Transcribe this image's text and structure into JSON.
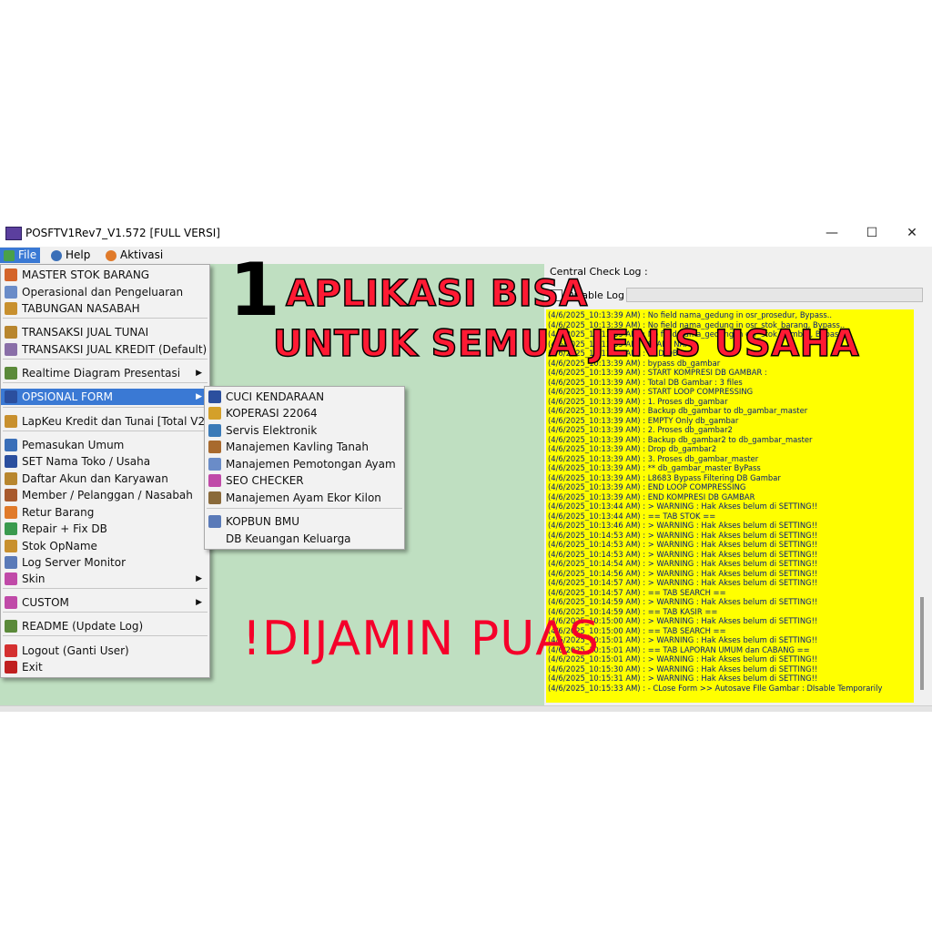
{
  "window": {
    "title": "POSFTV1Rev7_V1.572 [FULL VERSI]",
    "minimize": "—",
    "maximize": "☐",
    "close": "✕"
  },
  "menubar": [
    {
      "label": "File",
      "icon": "file-icon"
    },
    {
      "label": "Help",
      "icon": "help-icon"
    },
    {
      "label": "Aktivasi",
      "icon": "activation-icon"
    }
  ],
  "main_menu": {
    "items": [
      {
        "label": "MASTER STOK BARANG",
        "icon_color": "#d4642a"
      },
      {
        "label": "Operasional dan Pengeluaran",
        "icon_color": "#6a8cc8"
      },
      {
        "label": "TABUNGAN NASABAH",
        "icon_color": "#c8902e"
      },
      {
        "label": "TRANSAKSI JUAL TUNAI",
        "icon_color": "#b8862e"
      },
      {
        "label": "TRANSAKSI JUAL KREDIT (Default)",
        "icon_color": "#8a6fa8"
      },
      {
        "label": "Realtime Diagram Presentasi",
        "icon_color": "#5b8a3a"
      },
      {
        "label": "OPSIONAL FORM",
        "icon_color": "#2b4f9e"
      },
      {
        "label": "LapKeu Kredit dan Tunai [Total V2]",
        "icon_color": "#c8902e"
      },
      {
        "label": "Pemasukan Umum",
        "icon_color": "#3a6fb8"
      },
      {
        "label": "SET Nama Toko / Usaha",
        "icon_color": "#2b4f9e"
      },
      {
        "label": "Daftar Akun dan Karyawan",
        "icon_color": "#b8862e"
      },
      {
        "label": "Member / Pelanggan / Nasabah",
        "icon_color": "#a85a2e"
      },
      {
        "label": "Retur Barang",
        "icon_color": "#e07a2a"
      },
      {
        "label": "Repair + Fix DB",
        "icon_color": "#3a9a4e"
      },
      {
        "label": "Stok OpName",
        "icon_color": "#c8902e"
      },
      {
        "label": "Log Server Monitor",
        "icon_color": "#5a7ab8"
      },
      {
        "label": "Skin",
        "icon_color": "#c04aa8"
      },
      {
        "label": "CUSTOM",
        "icon_color": "#c04aa8"
      },
      {
        "label": "README (Update Log)",
        "icon_color": "#5b8a3a"
      },
      {
        "label": "Logout (Ganti User)",
        "icon_color": "#d43030"
      },
      {
        "label": "Exit",
        "icon_color": "#c02020"
      }
    ]
  },
  "sub_menu": {
    "items": [
      {
        "label": "CUCI KENDARAAN",
        "icon_color": "#2b4f9e"
      },
      {
        "label": "KOPERASI 22064",
        "icon_color": "#d4a02a"
      },
      {
        "label": "Servis Elektronik",
        "icon_color": "#3a7ab8"
      },
      {
        "label": "Manajemen Kavling Tanah",
        "icon_color": "#a86a2e"
      },
      {
        "label": "Manajemen Pemotongan Ayam",
        "icon_color": "#6a8cc8"
      },
      {
        "label": "SEO CHECKER",
        "icon_color": "#c04aa8"
      },
      {
        "label": "Manajemen Ayam Ekor Kilon",
        "icon_color": "#8a6a3a"
      },
      {
        "label": "KOPBUN BMU",
        "icon_color": "#5a7ab8"
      },
      {
        "label": "DB Keuangan Keluarga",
        "icon_color": ""
      }
    ]
  },
  "log_panel": {
    "title": "Central Check Log :",
    "disable_label": "Disable Log",
    "lines": [
      "(4/6/2025_10:13:39 AM) : No field nama_gedung in osr_prosedur, Bypass..",
      "(4/6/2025_10:13:39 AM) : No field nama_gedung in osr_stok_barang, Bypass..",
      "(4/6/2025_10:13:39 AM) : No field nama_gedung in osr_stok_gambar, Bypass..",
      "(4/6/2025_10:13:39 AM) : START NAMA",
      "(4/6/2025_10:13:39 AM) : END DB",
      "(4/6/2025_10:13:39 AM) : bypass db_gambar",
      "(4/6/2025_10:13:39 AM) : START KOMPRESI DB GAMBAR :",
      "(4/6/2025_10:13:39 AM) : Total DB Gambar : 3 files",
      "(4/6/2025_10:13:39 AM) : START LOOP COMPRESSING",
      "(4/6/2025_10:13:39 AM) : 1. Proses db_gambar",
      "(4/6/2025_10:13:39 AM) : Backup db_gambar to db_gambar_master",
      "(4/6/2025_10:13:39 AM) : EMPTY Only db_gambar",
      "(4/6/2025_10:13:39 AM) : 2. Proses db_gambar2",
      "(4/6/2025_10:13:39 AM) : Backup db_gambar2 to db_gambar_master",
      "(4/6/2025_10:13:39 AM) : Drop db_gambar2",
      "(4/6/2025_10:13:39 AM) : 3. Proses db_gambar_master",
      "(4/6/2025_10:13:39 AM) : ** db_gambar_master ByPass",
      "(4/6/2025_10:13:39 AM) : L8683 Bypass Filtering DB Gambar",
      "(4/6/2025_10:13:39 AM) : END LOOP COMPRESSING",
      "(4/6/2025_10:13:39 AM) : END KOMPRESI DB GAMBAR",
      "(4/6/2025_10:13:44 AM) : > WARNING : Hak Akses belum di SETTING!!",
      "(4/6/2025_10:13:44 AM) : == TAB STOK ==",
      "(4/6/2025_10:13:46 AM) : > WARNING : Hak Akses belum di SETTING!!",
      "(4/6/2025_10:14:53 AM) : > WARNING : Hak Akses belum di SETTING!!",
      "(4/6/2025_10:14:53 AM) : > WARNING : Hak Akses belum di SETTING!!",
      "(4/6/2025_10:14:53 AM) : > WARNING : Hak Akses belum di SETTING!!",
      "(4/6/2025_10:14:54 AM) : > WARNING : Hak Akses belum di SETTING!!",
      "(4/6/2025_10:14:56 AM) : > WARNING : Hak Akses belum di SETTING!!",
      "(4/6/2025_10:14:57 AM) : > WARNING : Hak Akses belum di SETTING!!",
      "(4/6/2025_10:14:57 AM) : == TAB SEARCH ==",
      "(4/6/2025_10:14:59 AM) : > WARNING : Hak Akses belum di SETTING!!",
      "(4/6/2025_10:14:59 AM) : == TAB KASIR ==",
      "(4/6/2025_10:15:00 AM) : > WARNING : Hak Akses belum di SETTING!!",
      "(4/6/2025_10:15:00 AM) : == TAB SEARCH ==",
      "(4/6/2025_10:15:01 AM) : > WARNING : Hak Akses belum di SETTING!!",
      "(4/6/2025_10:15:01 AM) : == TAB LAPORAN UMUM dan CABANG ==",
      "(4/6/2025_10:15:01 AM) : > WARNING : Hak Akses belum di SETTING!!",
      "(4/6/2025_10:15:30 AM) : > WARNING : Hak Akses belum di SETTING!!",
      "(4/6/2025_10:15:31 AM) : > WARNING : Hak Akses belum di SETTING!!",
      "(4/6/2025_10:15:33 AM) : - CLose Form >> Autosave FIle Gambar : DIsable Temporarily"
    ]
  },
  "promo": {
    "number": "1",
    "line1": "APLIKASI BISA",
    "line2": "UNTUK SEMUA JENIS USAHA",
    "line3": "!DIJAMIN PUAS"
  },
  "colors": {
    "accent": "#3a79d4",
    "client_bg": "#bfdfc1",
    "log_bg": "#ffff00",
    "promo_red": "#ff1a33"
  }
}
